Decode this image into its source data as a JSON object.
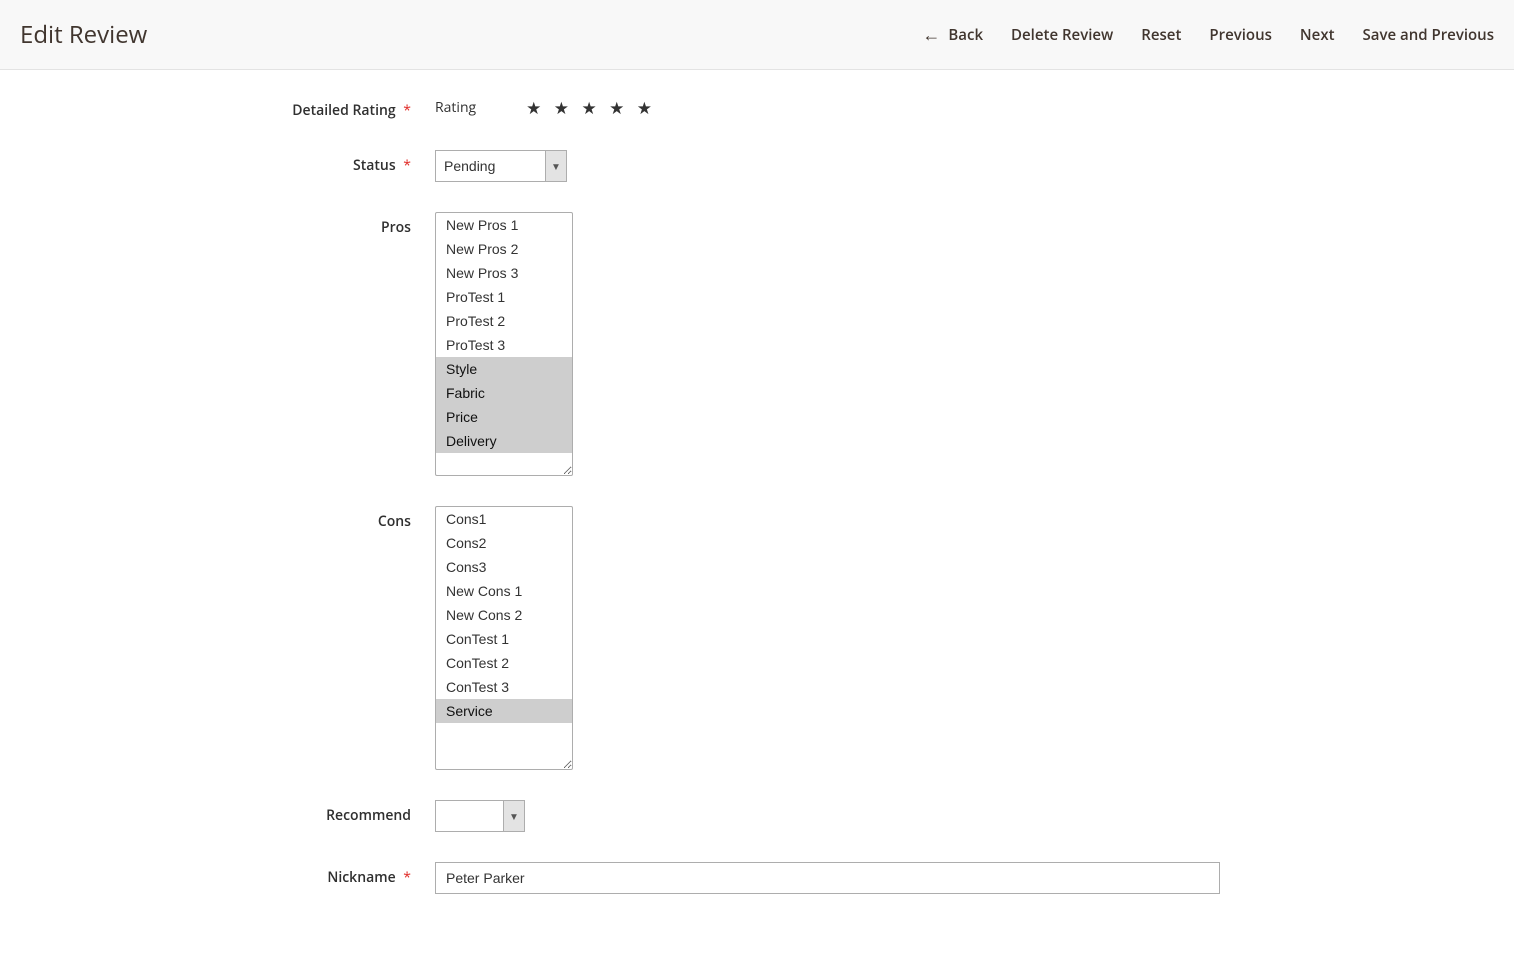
{
  "header": {
    "title": "Edit Review",
    "actions": {
      "back": "Back",
      "delete": "Delete Review",
      "reset": "Reset",
      "previous": "Previous",
      "next": "Next",
      "save_prev": "Save and Previous"
    }
  },
  "form": {
    "detailed_rating": {
      "label": "Detailed Rating",
      "rating_label": "Rating",
      "stars": "★ ★ ★ ★ ★"
    },
    "status": {
      "label": "Status",
      "selected": "Pending",
      "options": [
        "Pending"
      ]
    },
    "pros": {
      "label": "Pros",
      "options": [
        "New Pros 1",
        "New Pros 2",
        "New Pros 3",
        "ProTest 1",
        "ProTest 2",
        "ProTest 3",
        "Style",
        "Fabric",
        "Price",
        "Delivery"
      ],
      "selected": [
        "Style",
        "Fabric",
        "Price",
        "Delivery"
      ]
    },
    "cons": {
      "label": "Cons",
      "options": [
        "Cons1",
        "Cons2",
        "Cons3",
        "New Cons 1",
        "New Cons 2",
        "ConTest 1",
        "ConTest 2",
        "ConTest 3",
        "Service"
      ],
      "selected": [
        "Service"
      ]
    },
    "recommend": {
      "label": "Recommend",
      "selected": "",
      "options": [
        ""
      ]
    },
    "nickname": {
      "label": "Nickname",
      "value": "Peter Parker"
    }
  }
}
